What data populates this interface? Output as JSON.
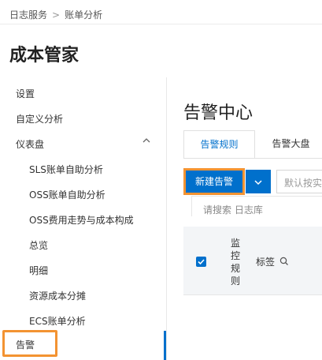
{
  "breadcrumb": {
    "root": "日志服务",
    "separator": ">",
    "current": "账单分析"
  },
  "app": {
    "title": "成本管家"
  },
  "sidebar": {
    "items": [
      {
        "label": "设置"
      },
      {
        "label": "自定义分析"
      },
      {
        "label": "仪表盘",
        "expanded": true,
        "chevron": "chevron-up-icon"
      },
      {
        "label": "SLS账单自助分析"
      },
      {
        "label": "OSS账单自助分析"
      },
      {
        "label": "OSS费用走势与成本构成"
      },
      {
        "label": "总览"
      },
      {
        "label": "明细"
      },
      {
        "label": "资源成本分摊"
      },
      {
        "label": "ECS账单分析"
      },
      {
        "label": "告警",
        "active": true
      }
    ]
  },
  "main": {
    "title": "告警中心",
    "tabs": [
      {
        "label": "告警规则",
        "active": true
      },
      {
        "label": "告警大盘",
        "active": false
      }
    ],
    "toolbar": {
      "new_button": "新建告警",
      "dropdown_icon": "chevron-down-icon",
      "search_placeholder": "默认按实",
      "filter_hint": "请搜索 日志库"
    },
    "table": {
      "select_all_checked": true,
      "columns": {
        "monitor": [
          "监",
          "控",
          "规",
          "则"
        ],
        "label": "标签"
      }
    }
  },
  "colors": {
    "accent": "#0070cc",
    "highlight": "#f39332"
  }
}
